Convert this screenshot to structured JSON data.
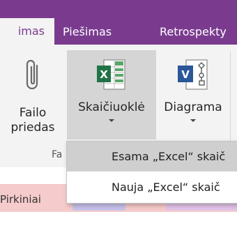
{
  "tabs": [
    {
      "label": "imas",
      "active": true
    },
    {
      "label": "Piešimas",
      "active": false
    },
    {
      "label": "Retrospekty",
      "active": false
    }
  ],
  "ribbon": {
    "attach": {
      "line1": "Failo",
      "line2": "priedas"
    },
    "spreadsheet": {
      "label": "Skaičiuoklė"
    },
    "diagram": {
      "label": "Diagrama"
    },
    "group_label": "Fa"
  },
  "menu": {
    "items": [
      {
        "label": "Esama „Excel“ skaič"
      },
      {
        "label": "Nauja „Excel“ skaič"
      }
    ]
  },
  "page": {
    "cells": [
      "Pirkiniai"
    ]
  },
  "colors": {
    "accent": "#7a3b8f",
    "excel": "#217346",
    "visio": "#2b579a",
    "row_band": "#f6cbcb"
  }
}
